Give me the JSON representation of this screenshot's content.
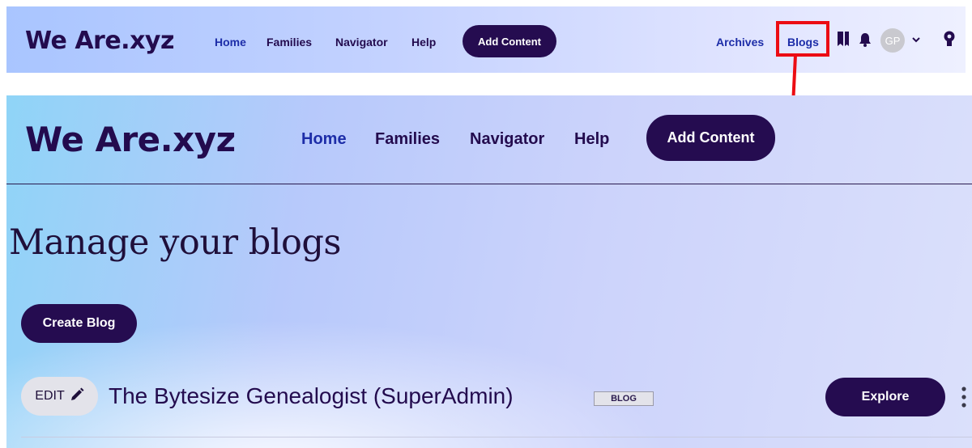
{
  "colors": {
    "brand_dark": "#250c50",
    "link_active": "#1d2da8",
    "highlight_red": "#ec0c13"
  },
  "topbar": {
    "logo": "We Are.xyz",
    "nav": [
      "Home",
      "Families",
      "Navigator",
      "Help"
    ],
    "active_nav": "Home",
    "add_content_label": "Add Content",
    "archives_label": "Archives",
    "blogs_label": "Blogs",
    "icons": [
      "bookmark-icon",
      "bell-icon",
      "chevron-down-icon",
      "profile-icon"
    ],
    "avatar_initials": "GP"
  },
  "page": {
    "logo": "We Are.xyz",
    "nav": [
      "Home",
      "Families",
      "Navigator",
      "Help"
    ],
    "active_nav": "Home",
    "add_content_label": "Add Content",
    "heading": "Manage your blogs",
    "create_blog_label": "Create Blog",
    "blog_row": {
      "edit_label": "EDIT",
      "title": "The Bytesize Genealogist (SuperAdmin)",
      "badge": "BLOG",
      "explore_label": "Explore"
    }
  }
}
